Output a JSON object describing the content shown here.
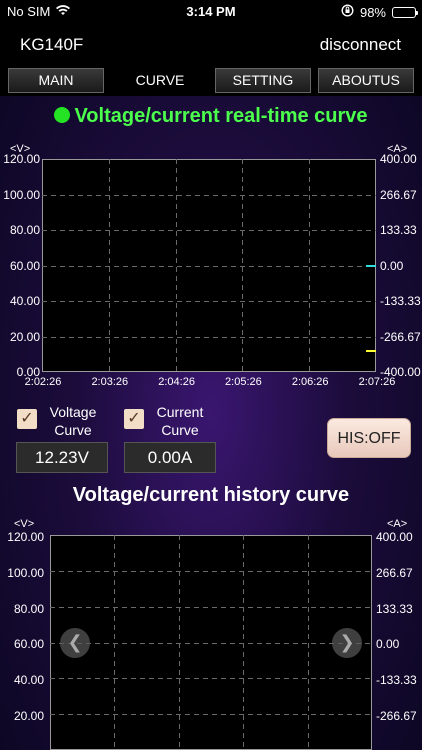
{
  "status_bar": {
    "carrier": "No SIM",
    "time": "3:14 PM",
    "battery_pct": "98%",
    "icons": [
      "wifi-icon",
      "orientation-lock-icon",
      "battery-charging-icon"
    ]
  },
  "nav": {
    "title": "KG140F",
    "action": "disconnect"
  },
  "tabs": [
    {
      "label": "MAIN",
      "active": false
    },
    {
      "label": "CURVE",
      "active": true
    },
    {
      "label": "SETTING",
      "active": false
    },
    {
      "label": "ABOUTUS",
      "active": false
    }
  ],
  "realtime": {
    "title": "Voltage/current real-time curve",
    "left_unit": "<V>",
    "right_unit": "<A>",
    "left_ticks": [
      "120.00",
      "100.00",
      "80.00",
      "60.00",
      "40.00",
      "20.00",
      "0.00"
    ],
    "right_ticks": [
      "400.00",
      "266.67",
      "133.33",
      "0.00",
      "-133.33",
      "-266.67",
      "-400.00"
    ],
    "x_ticks": [
      "2:02:26",
      "2:03:26",
      "2:04:26",
      "2:05:26",
      "2:06:26",
      "2:07:26"
    ],
    "voltage_marker_color": "#ffff33",
    "current_marker_color": "#33dddd"
  },
  "controls": {
    "voltage_checkbox": {
      "label_line1": "Voltage",
      "label_line2": "Curve",
      "checked": true,
      "check_glyph": "✓"
    },
    "current_checkbox": {
      "label_line1": "Current",
      "label_line2": "Curve",
      "checked": true,
      "check_glyph": "✓"
    },
    "voltage_value": "12.23V",
    "current_value": "0.00A",
    "history_button": "HIS:OFF"
  },
  "history": {
    "title": "Voltage/current history curve",
    "left_unit": "<V>",
    "right_unit": "<A>",
    "left_ticks": [
      "120.00",
      "100.00",
      "80.00",
      "60.00",
      "40.00",
      "20.00"
    ],
    "right_ticks": [
      "400.00",
      "266.67",
      "133.33",
      "0.00",
      "-133.33",
      "-266.67"
    ],
    "prev_glyph": "❮",
    "next_glyph": "❯"
  },
  "colors": {
    "title_green": "#4cff4c",
    "grid": "#6a6a6a",
    "plot_bg": "#000000"
  }
}
